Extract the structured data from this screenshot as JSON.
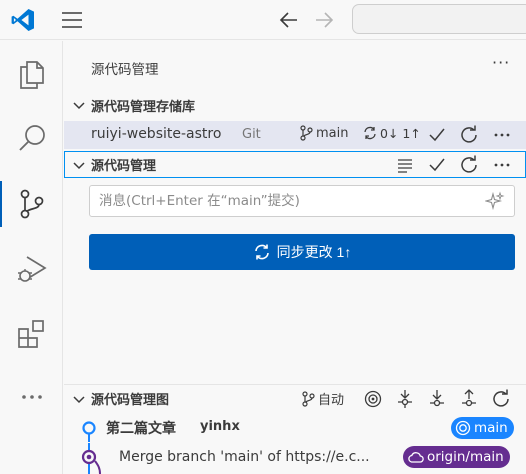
{
  "titlebar": {
    "search_placeholder": ""
  },
  "panel": {
    "title": "源代码管理",
    "more": "···"
  },
  "repositories": {
    "section_label": "源代码管理存储库",
    "repo_name": "ruiyi-website-astro",
    "repo_type": "Git",
    "branch": "main",
    "sync_status": "0↓ 1↑"
  },
  "scm": {
    "section_label": "源代码管理",
    "message_placeholder": "消息(Ctrl+Enter 在“main”提交)",
    "sync_button_label": "同步更改 1↑"
  },
  "graph": {
    "section_label": "源代码管理图",
    "auto_label": "自动",
    "commits": [
      {
        "title": "第二篇文章",
        "author": "yinhx",
        "badge": "main"
      },
      {
        "message": "Merge branch 'main' of https://e.c...",
        "badge": "origin/main"
      }
    ]
  },
  "colors": {
    "accent": "#005fb8",
    "badge_main": "#1a85ff",
    "badge_origin": "#652d90",
    "logo": "#0078d4"
  }
}
